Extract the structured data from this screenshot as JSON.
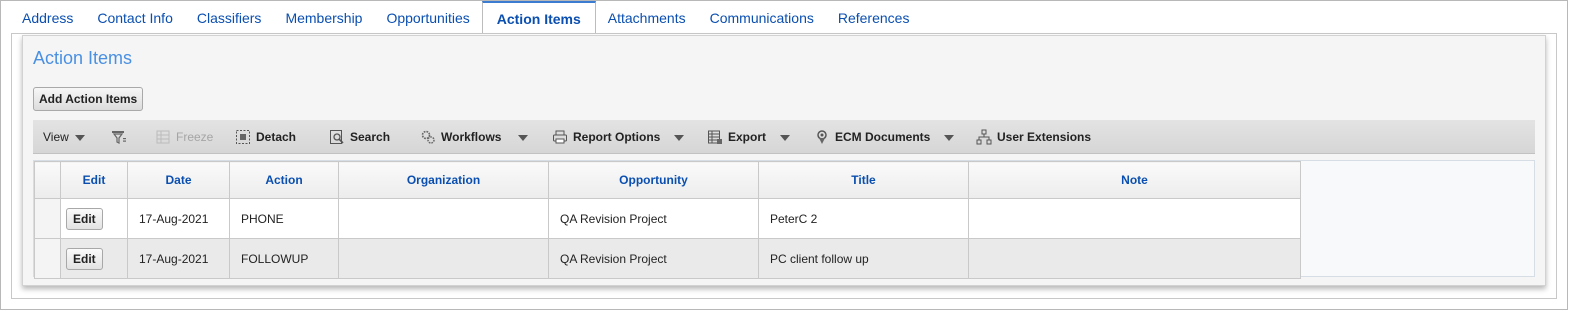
{
  "tabs": [
    {
      "label": "Address"
    },
    {
      "label": "Contact Info"
    },
    {
      "label": "Classifiers"
    },
    {
      "label": "Membership"
    },
    {
      "label": "Opportunities"
    },
    {
      "label": "Action Items",
      "active": true
    },
    {
      "label": "Attachments"
    },
    {
      "label": "Communications"
    },
    {
      "label": "References"
    }
  ],
  "panel": {
    "title": "Action Items",
    "add_button_label": "Add Action Items"
  },
  "toolbar": {
    "view_label": "View",
    "freeze_label": "Freeze",
    "detach_label": "Detach",
    "search_label": "Search",
    "workflows_label": "Workflows",
    "report_options_label": "Report Options",
    "export_label": "Export",
    "ecm_documents_label": "ECM Documents",
    "user_extensions_label": "User Extensions",
    "icons": [
      "filter-icon",
      "freeze-icon",
      "detach-icon",
      "search-icon",
      "workflows-icon",
      "print-icon",
      "export-icon",
      "ecm-documents-icon",
      "user-extensions-icon"
    ]
  },
  "grid": {
    "columns": [
      "Edit",
      "Date",
      "Action",
      "Organization",
      "Opportunity",
      "Title",
      "Note"
    ],
    "edit_button_label": "Edit",
    "rows": [
      {
        "date": "17-Aug-2021",
        "action": "PHONE",
        "organization": "",
        "opportunity": "QA Revision Project",
        "title": "PeterC 2",
        "note": ""
      },
      {
        "date": "17-Aug-2021",
        "action": "FOLLOWUP",
        "organization": "",
        "opportunity": "QA Revision Project",
        "title": "PC client follow up",
        "note": ""
      }
    ]
  },
  "colors": {
    "link_blue": "#0a4fb0",
    "title_blue": "#4a90e2",
    "active_tab_border": "#3b7bd0"
  }
}
